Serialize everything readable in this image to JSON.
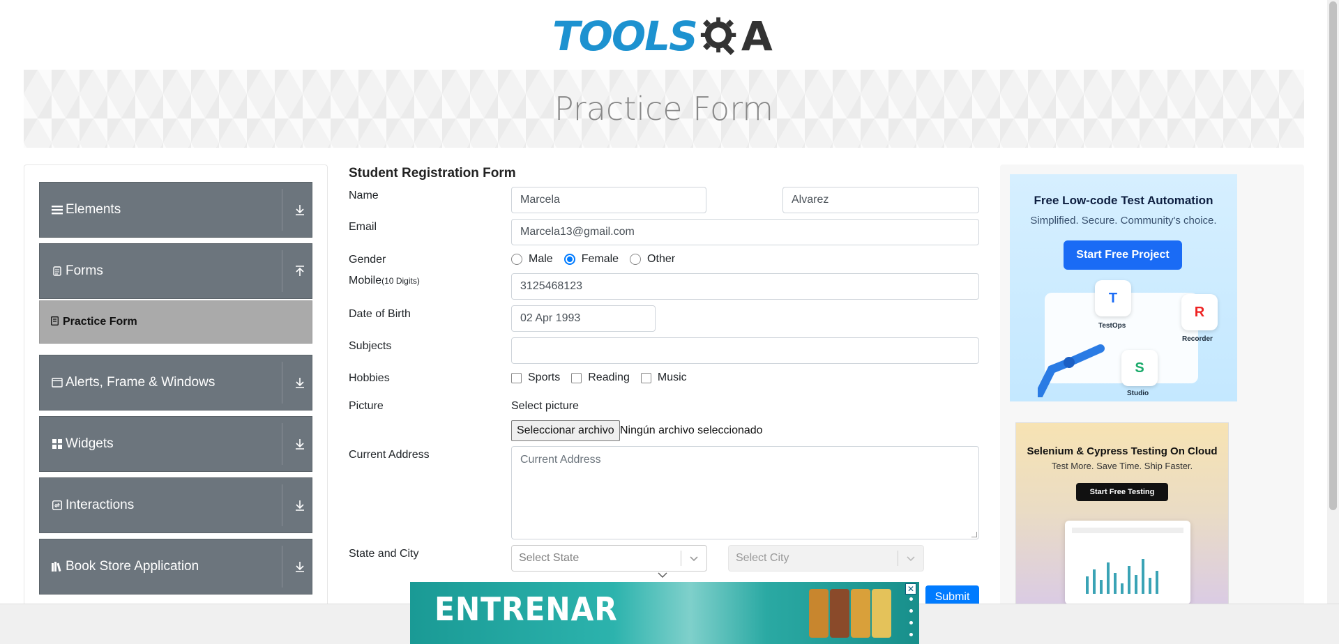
{
  "header": {
    "logo_text_left": "TOOLS",
    "logo_text_right": "A"
  },
  "banner": {
    "title": "Practice Form"
  },
  "sidebar": {
    "groups": [
      {
        "label": "Elements",
        "icon": "hamburger-icon",
        "expanded": false
      },
      {
        "label": "Forms",
        "icon": "document-icon",
        "expanded": true
      },
      {
        "label": "Alerts, Frame & Windows",
        "icon": "window-icon",
        "expanded": false
      },
      {
        "label": "Widgets",
        "icon": "grid-icon",
        "expanded": false
      },
      {
        "label": "Interactions",
        "icon": "interactions-icon",
        "expanded": false
      },
      {
        "label": "Book Store Application",
        "icon": "books-icon",
        "expanded": false
      }
    ],
    "active_item": {
      "label": "Practice Form",
      "icon": "form-icon"
    }
  },
  "form": {
    "title": "Student Registration Form",
    "labels": {
      "name": "Name",
      "email": "Email",
      "gender": "Gender",
      "mobile": "Mobile",
      "mobile_hint": "(10 Digits)",
      "dob": "Date of Birth",
      "subjects": "Subjects",
      "hobbies": "Hobbies",
      "picture": "Picture",
      "address": "Current Address",
      "state_city": "State and City"
    },
    "first_name": "Marcela",
    "last_name": "Alvarez",
    "email": "Marcela13@gmail.com",
    "gender_options": [
      "Male",
      "Female",
      "Other"
    ],
    "gender_selected": "Female",
    "mobile": "3125468123",
    "dob": "02 Apr 1993",
    "subjects": "",
    "hobbies": [
      "Sports",
      "Reading",
      "Music"
    ],
    "picture_caption": "Select picture",
    "file_button": "Seleccionar archivo",
    "file_status": "Ningún archivo seleccionado",
    "address_placeholder": "Current Address",
    "state_placeholder": "Select State",
    "city_placeholder": "Select City",
    "submit_label": "Submit"
  },
  "ads": {
    "ad1": {
      "headline": "Free Low-code Test Automation",
      "subline": "Simplified. Secure. Community's choice.",
      "cta": "Start Free Project",
      "products": [
        "TestOps",
        "Recorder",
        "Studio"
      ]
    },
    "ad2": {
      "headline": "Selenium & Cypress Testing On Cloud",
      "subline": "Test More. Save Time. Ship Faster.",
      "cta": "Start Free Testing"
    },
    "bottom": {
      "headline": "ENTRENAR",
      "close": "✕"
    }
  },
  "colors": {
    "sidebar_group": "#6c757d",
    "active_item": "#aaaaaa",
    "primary": "#007bff",
    "logo_blue": "#1d92d0"
  }
}
